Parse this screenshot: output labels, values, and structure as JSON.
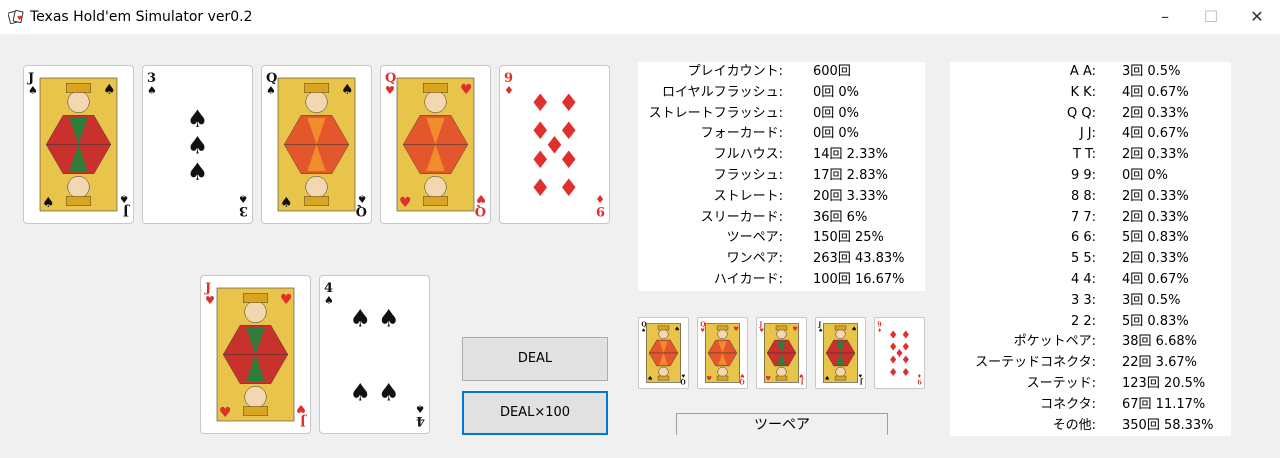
{
  "window": {
    "title": "Texas Hold'em Simulator ver0.2",
    "minimize_glyph": "–",
    "maximize_glyph": "☐",
    "close_glyph": "✕"
  },
  "colors": {
    "red": "#e0302e",
    "black": "#111111",
    "gold": "#e9c44b",
    "accent": "#0078d7"
  },
  "board_cards": [
    {
      "rank": "J",
      "suit": "spade",
      "suit_glyph": "♠",
      "face": true
    },
    {
      "rank": "3",
      "suit": "spade",
      "suit_glyph": "♠",
      "face": false
    },
    {
      "rank": "Q",
      "suit": "spade",
      "suit_glyph": "♠",
      "face": true
    },
    {
      "rank": "Q",
      "suit": "heart",
      "suit_glyph": "♥",
      "face": true
    },
    {
      "rank": "9",
      "suit": "diamond",
      "suit_glyph": "♦",
      "face": false
    }
  ],
  "hole_cards": [
    {
      "rank": "J",
      "suit": "heart",
      "suit_glyph": "♥",
      "face": true
    },
    {
      "rank": "4",
      "suit": "spade",
      "suit_glyph": "♠",
      "face": false
    }
  ],
  "buttons": {
    "deal": "DEAL",
    "deal100": "DEAL×100"
  },
  "stats": [
    {
      "label": "プレイカウント:",
      "value": "600回"
    },
    {
      "label": "ロイヤルフラッシュ:",
      "value": "0回 0%"
    },
    {
      "label": "ストレートフラッシュ:",
      "value": "0回 0%"
    },
    {
      "label": "フォーカード:",
      "value": "0回 0%"
    },
    {
      "label": "フルハウス:",
      "value": "14回 2.33%"
    },
    {
      "label": "フラッシュ:",
      "value": "17回 2.83%"
    },
    {
      "label": "ストレート:",
      "value": "20回 3.33%"
    },
    {
      "label": "スリーカード:",
      "value": "36回 6%"
    },
    {
      "label": "ツーペア:",
      "value": "150回 25%"
    },
    {
      "label": "ワンペア:",
      "value": "263回 43.83%"
    },
    {
      "label": "ハイカード:",
      "value": "100回 16.67%"
    }
  ],
  "best_hand_cards": [
    {
      "rank": "Q",
      "suit": "spade",
      "suit_glyph": "♠",
      "face": true
    },
    {
      "rank": "Q",
      "suit": "heart",
      "suit_glyph": "♥",
      "face": true
    },
    {
      "rank": "J",
      "suit": "heart",
      "suit_glyph": "♥",
      "face": true
    },
    {
      "rank": "J",
      "suit": "spade",
      "suit_glyph": "♠",
      "face": true
    },
    {
      "rank": "9",
      "suit": "diamond",
      "suit_glyph": "♦",
      "face": false
    }
  ],
  "hand_result": "ツーペア",
  "pair_stats": [
    {
      "label": "A A:",
      "value": "3回 0.5%"
    },
    {
      "label": "K K:",
      "value": "4回 0.67%"
    },
    {
      "label": "Q Q:",
      "value": "2回 0.33%"
    },
    {
      "label": "J J:",
      "value": "4回 0.67%"
    },
    {
      "label": "T T:",
      "value": "2回 0.33%"
    },
    {
      "label": "9 9:",
      "value": "0回 0%"
    },
    {
      "label": "8 8:",
      "value": "2回 0.33%"
    },
    {
      "label": "7 7:",
      "value": "2回 0.33%"
    },
    {
      "label": "6 6:",
      "value": "5回 0.83%"
    },
    {
      "label": "5 5:",
      "value": "2回 0.33%"
    },
    {
      "label": "4 4:",
      "value": "4回 0.67%"
    },
    {
      "label": "3 3:",
      "value": "3回 0.5%"
    },
    {
      "label": "2 2:",
      "value": "5回 0.83%"
    },
    {
      "label": "ポケットペア:",
      "value": "38回 6.68%"
    },
    {
      "label": "スーテッドコネクタ:",
      "value": "22回 3.67%"
    },
    {
      "label": "スーテッド:",
      "value": "123回 20.5%"
    },
    {
      "label": "コネクタ:",
      "value": "67回 11.17%"
    },
    {
      "label": "その他:",
      "value": "350回 58.33%"
    }
  ]
}
